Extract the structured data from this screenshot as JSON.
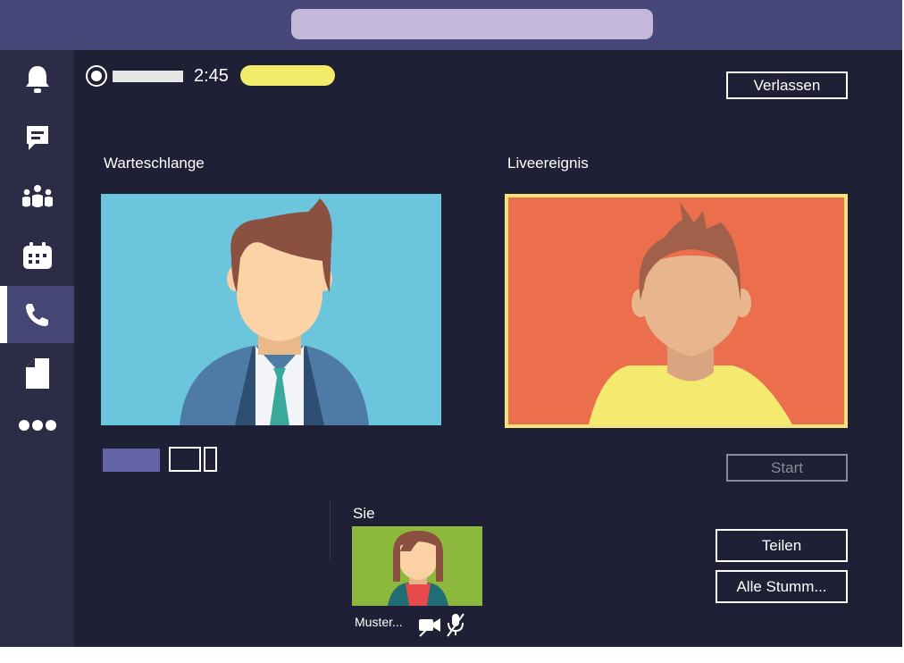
{
  "search": {
    "placeholder": "",
    "value": ""
  },
  "rail": {
    "items": [
      {
        "name": "activity",
        "icon": "bell-icon"
      },
      {
        "name": "chat",
        "icon": "chat-icon"
      },
      {
        "name": "teams",
        "icon": "teams-icon"
      },
      {
        "name": "calendar",
        "icon": "calendar-icon"
      },
      {
        "name": "calls",
        "icon": "phone-icon",
        "active": true
      },
      {
        "name": "files",
        "icon": "file-icon"
      },
      {
        "name": "more",
        "icon": "more-icon"
      }
    ]
  },
  "recording": {
    "time": "2:45",
    "icon": "record-icon"
  },
  "header": {
    "leave_label": "Verlassen"
  },
  "queue": {
    "title": "Warteschlange"
  },
  "live": {
    "title": "Liveereignis",
    "start_label": "Start",
    "start_enabled": false
  },
  "self": {
    "title": "Sie",
    "name": "Muster...",
    "camera_icon": "video-camera-icon",
    "mic_icon": "mic-muted-icon"
  },
  "actions": {
    "share_label": "Teilen",
    "mute_all_label": "Alle Stumm..."
  },
  "colors": {
    "background": "#1f1f35",
    "topbar": "#474779",
    "rail": "#2d2c47",
    "rail_active": "#464675",
    "search": "#c3b8da",
    "accent": "#6264a7",
    "live_pill": "#f3eb6a",
    "queue_video_bg": "#6bc6dd",
    "live_video_bg": "#ec6f4d",
    "live_video_border": "#f3e37a",
    "self_video_bg": "#8cb83d"
  }
}
